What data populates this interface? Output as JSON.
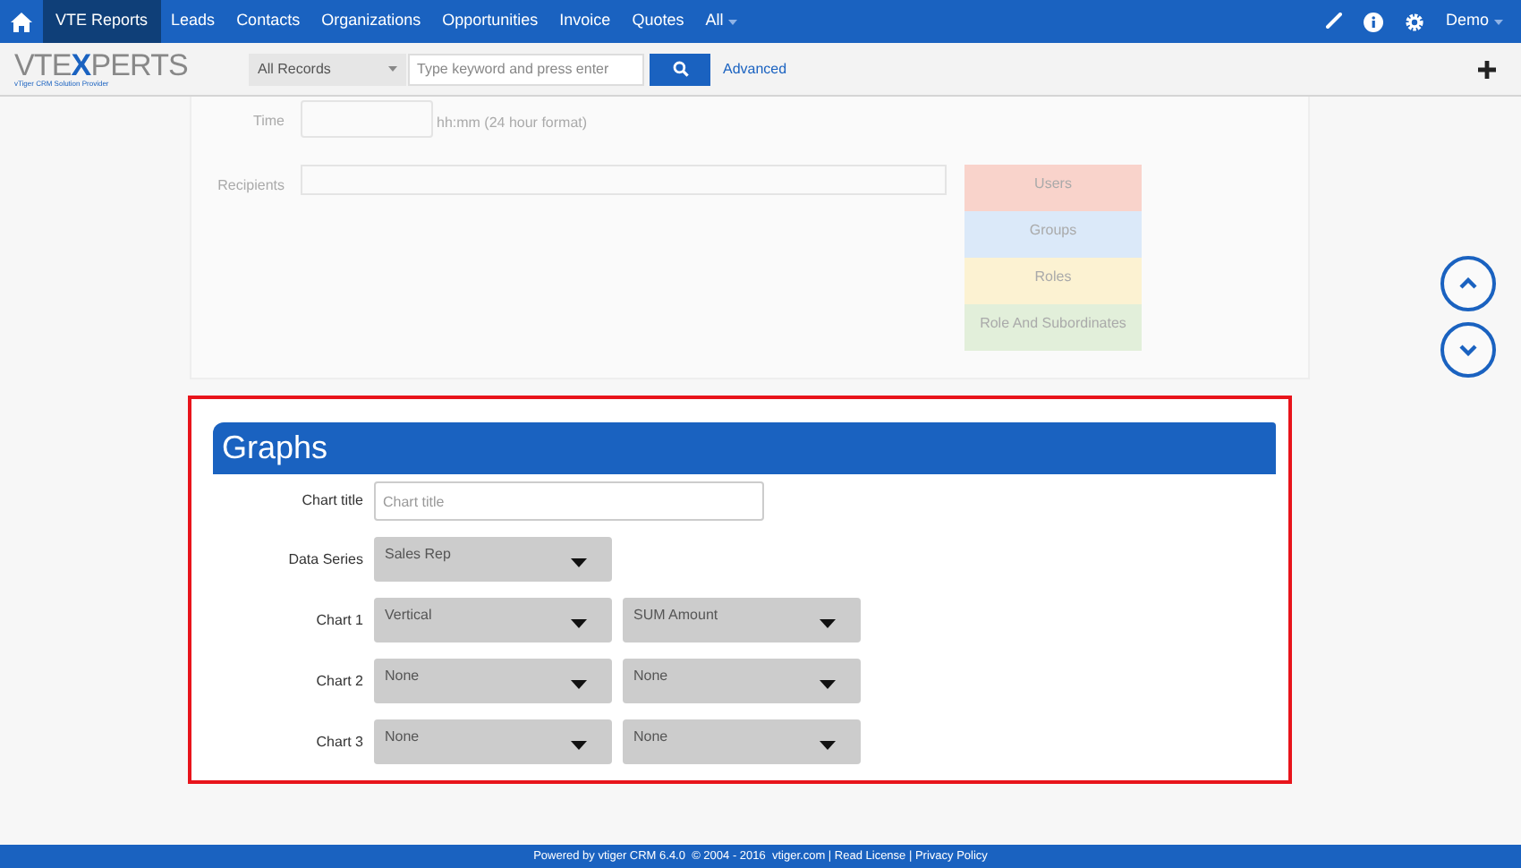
{
  "nav": {
    "items": [
      {
        "label": "VTE Reports",
        "selected": true
      },
      {
        "label": "Leads",
        "selected": false
      },
      {
        "label": "Contacts",
        "selected": false
      },
      {
        "label": "Organizations",
        "selected": false
      },
      {
        "label": "Opportunities",
        "selected": false
      },
      {
        "label": "Invoice",
        "selected": false
      },
      {
        "label": "Quotes",
        "selected": false
      },
      {
        "label": "All",
        "selected": false
      }
    ],
    "user": "Demo"
  },
  "logo": {
    "parts": [
      "VTE",
      "X",
      "PERTS"
    ],
    "tagline": "vTiger CRM Solution Provider"
  },
  "search": {
    "filter": "All Records",
    "placeholder": "Type keyword and press enter",
    "advanced": "Advanced"
  },
  "schedule": {
    "time_label": "Time",
    "time_hint": "hh:mm (24 hour format)",
    "recipients_label": "Recipients",
    "recipient_types": [
      {
        "label": "Users",
        "color": "#f9d3cb"
      },
      {
        "label": "Groups",
        "color": "#dbe9f9"
      },
      {
        "label": "Roles",
        "color": "#fcf2d2"
      },
      {
        "label": "Role And Subordinates",
        "color": "#e2efda"
      }
    ]
  },
  "graphs": {
    "title": "Graphs",
    "chart_title": {
      "label": "Chart title",
      "placeholder": "Chart title"
    },
    "rows": [
      {
        "label": "Data Series",
        "selects": [
          "Sales Rep"
        ]
      },
      {
        "label": "Chart 1",
        "selects": [
          "Vertical",
          "SUM Amount"
        ]
      },
      {
        "label": "Chart 2",
        "selects": [
          "None",
          "None"
        ]
      },
      {
        "label": "Chart 3",
        "selects": [
          "None",
          "None"
        ]
      }
    ]
  },
  "footer": "Powered by vtiger CRM 6.4.0  © 2004 - 2016  vtiger.com | Read License | Privacy Policy"
}
